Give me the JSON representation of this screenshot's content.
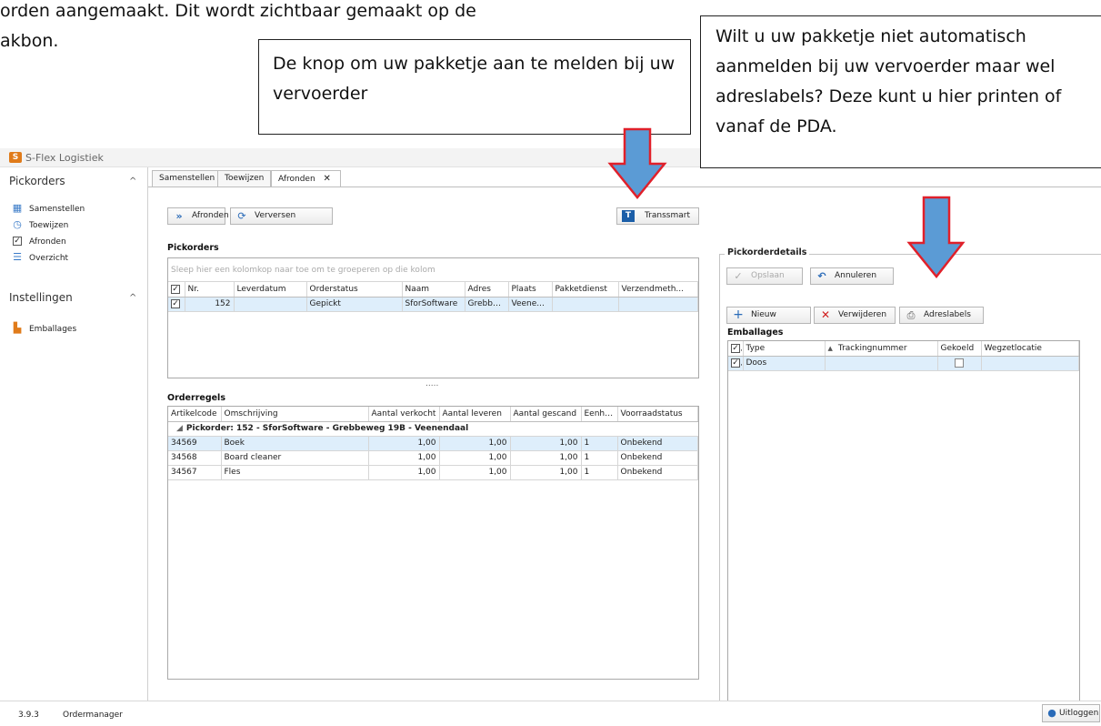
{
  "document": {
    "line1": "orden aangemaakt. Dit wordt zichtbaar gemaakt op de",
    "line2": "akbon."
  },
  "callouts": {
    "transsmart": "De knop om uw pakketje aan te melden bij uw vervoerder",
    "labels": "Wilt u uw pakketje niet automatisch aanmelden bij uw vervoerder maar wel adreslabels? Deze kunt u hier printen of vanaf de PDA."
  },
  "colors": {
    "arrow_fill": "#5b9bd5",
    "arrow_stroke": "#e0202a",
    "selection": "#deeefb"
  },
  "app": {
    "title": "S-Flex Logistiek",
    "logo_icon": "sflex-logo-icon"
  },
  "sidebar": {
    "groups": [
      {
        "label": "Pickorders",
        "items": [
          {
            "label": "Samenstellen",
            "icon": "calendar-icon"
          },
          {
            "label": "Toewijzen",
            "icon": "clock-icon"
          },
          {
            "label": "Afronden",
            "icon": "check-icon"
          },
          {
            "label": "Overzicht",
            "icon": "list-icon"
          }
        ]
      },
      {
        "label": "Instellingen",
        "items": [
          {
            "label": "Emballages",
            "icon": "cart-icon"
          }
        ]
      }
    ]
  },
  "tabs": [
    {
      "label": "Samenstellen"
    },
    {
      "label": "Toewijzen"
    },
    {
      "label": "Afronden",
      "close": "✕"
    }
  ],
  "toolbar": {
    "afronden": "Afronden",
    "verversen": "Verversen",
    "transsmart": "Transsmart",
    "transsmart_glyph": "T"
  },
  "pickorders": {
    "label": "Pickorders",
    "group_hint": "Sleep hier een kolomkop naar toe om te groeperen op die kolom",
    "columns": [
      "Nr.",
      "Leverdatum",
      "Orderstatus",
      "Naam",
      "Adres",
      "Plaats",
      "Pakketdienst",
      "Verzendmeth..."
    ],
    "rows": [
      {
        "nr": "152",
        "leverdatum": "",
        "orderstatus": "Gepickt",
        "naam": "SforSoftware",
        "adres": "Grebbewe...",
        "plaats": "Veene...",
        "pakketdienst": "",
        "verzendmethode": ""
      }
    ],
    "splitter": "....."
  },
  "orderregels": {
    "label": "Orderregels",
    "columns": [
      "Artikelcode",
      "Omschrijving",
      "Aantal verkocht",
      "Aantal leveren",
      "Aantal gescand",
      "Eenheid",
      "Voorraadstatus"
    ],
    "group_row": "Pickorder: 152 - SforSoftware - Grebbeweg 19B - Veenendaal",
    "rows": [
      [
        "34569",
        "Boek",
        "1,00",
        "1,00",
        "1,00",
        "1",
        "Onbekend"
      ],
      [
        "34568",
        "Board cleaner",
        "1,00",
        "1,00",
        "1,00",
        "1",
        "Onbekend"
      ],
      [
        "34567",
        "Fles",
        "1,00",
        "1,00",
        "1,00",
        "1",
        "Onbekend"
      ]
    ]
  },
  "details": {
    "label": "Pickorderdetails",
    "opslaan": "Opslaan",
    "annuleren": "Annuleren",
    "nieuw": "Nieuw",
    "verwijderen": "Verwijderen",
    "adreslabels": "Adreslabels",
    "emballages_label": "Emballages",
    "columns": [
      "Type",
      "Trackingnummer",
      "Gekoeld",
      "Wegzetlocatie"
    ],
    "rows": [
      {
        "type": "Doos",
        "tracking": "",
        "gekoeld": false,
        "wegzet": ""
      }
    ]
  },
  "status": {
    "version": "3.9.3",
    "module": "Ordermanager",
    "logout": "Uitloggen"
  }
}
